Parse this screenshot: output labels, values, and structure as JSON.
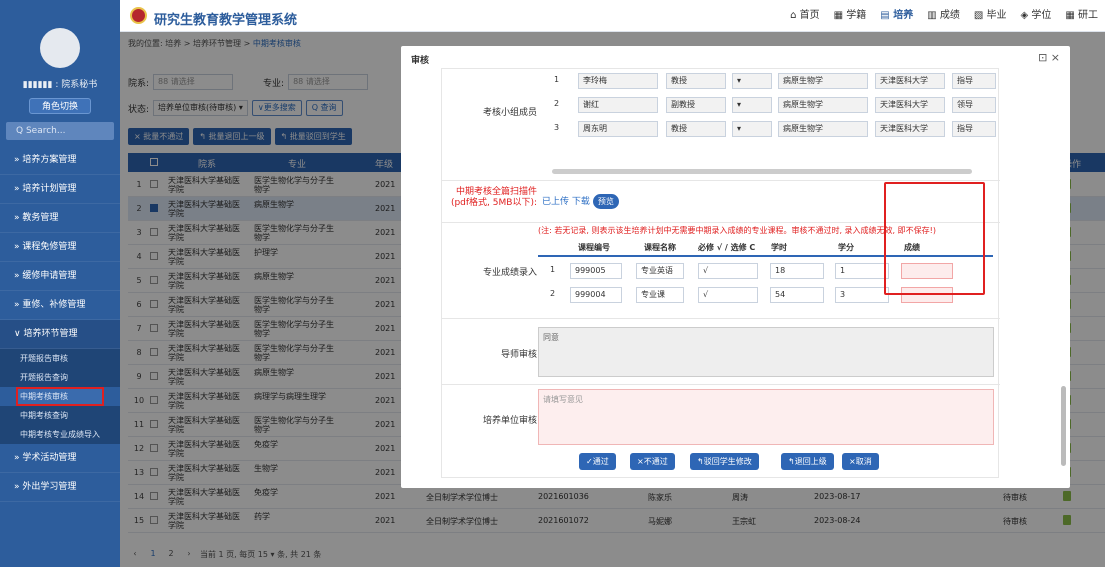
{
  "app": {
    "title": "研究生教育教学管理系统"
  },
  "topnav": [
    {
      "label": "⌂ 首页",
      "active": false
    },
    {
      "label": "▦ 学籍",
      "active": false
    },
    {
      "label": "▤ 培养",
      "active": true
    },
    {
      "label": "▥ 成绩",
      "active": false
    },
    {
      "label": "▧ 毕业",
      "active": false
    },
    {
      "label": "◈ 学位",
      "active": false
    },
    {
      "label": "▦ 研工",
      "active": false
    }
  ],
  "sidebar": {
    "user": "▮▮▮▮▮▮ : 院系秘书",
    "role_button": "角色切换",
    "search_placeholder": "Q  Search...",
    "menu": [
      {
        "label": "»  培养方案管理"
      },
      {
        "label": "»  培养计划管理"
      },
      {
        "label": "»  教务管理"
      },
      {
        "label": "»  课程免修管理"
      },
      {
        "label": "»  缓修申请管理"
      },
      {
        "label": "»  重修、补修管理"
      },
      {
        "label": "∨  培养环节管理"
      }
    ],
    "submenu": [
      {
        "label": "开题报告审核"
      },
      {
        "label": "开题报告查询"
      },
      {
        "label": "中期考核审核"
      },
      {
        "label": "中期考核查询"
      },
      {
        "label": "中期考核专业成绩导入"
      }
    ],
    "menu_after": [
      {
        "label": "»  学术活动管理"
      },
      {
        "label": "»  外出学习管理"
      }
    ]
  },
  "breadcrumb": {
    "prefix": "我的位置:  培养 > 培养环节管理 > ",
    "current": "中期考核审核"
  },
  "filters": {
    "dept_label": "院系:",
    "dept_value": "88  请选择",
    "major_label": "专业:",
    "major_value": "88  请选择",
    "status_label": "状态:",
    "status_value": "培养单位审核(待审核) ▾",
    "more_search": "∨更多搜索",
    "query": "Q 查询"
  },
  "actions": {
    "reject": "× 批量不通过",
    "back_one": "↰ 批量退回上一级",
    "back_student": "↰ 批量驳回到学生"
  },
  "table": {
    "headers": [
      "院系",
      "专业",
      "年级",
      "操作"
    ],
    "rows": [
      {
        "num": "1",
        "college": "天津医科大学基础医学院",
        "major": "医学生物化学与分子生物学",
        "year": "2021",
        "selected": false
      },
      {
        "num": "2",
        "college": "天津医科大学基础医学院",
        "major": "病原生物学",
        "year": "2021",
        "selected": true
      },
      {
        "num": "3",
        "college": "天津医科大学基础医学院",
        "major": "医学生物化学与分子生物学",
        "year": "2021",
        "selected": false
      },
      {
        "num": "4",
        "college": "天津医科大学基础医学院",
        "major": "护理学",
        "year": "2021",
        "selected": false
      },
      {
        "num": "5",
        "college": "天津医科大学基础医学院",
        "major": "病原生物学",
        "year": "2021",
        "selected": false
      },
      {
        "num": "6",
        "college": "天津医科大学基础医学院",
        "major": "医学生物化学与分子生物学",
        "year": "2021",
        "selected": false
      },
      {
        "num": "7",
        "college": "天津医科大学基础医学院",
        "major": "医学生物化学与分子生物学",
        "year": "2021",
        "selected": false
      },
      {
        "num": "8",
        "college": "天津医科大学基础医学院",
        "major": "医学生物化学与分子生物学",
        "year": "2021",
        "selected": false
      },
      {
        "num": "9",
        "college": "天津医科大学基础医学院",
        "major": "病原生物学",
        "year": "2021",
        "selected": false
      },
      {
        "num": "10",
        "college": "天津医科大学基础医学院",
        "major": "病理学与病理生理学",
        "year": "2021",
        "selected": false
      },
      {
        "num": "11",
        "college": "天津医科大学基础医学院",
        "major": "医学生物化学与分子生物学",
        "year": "2021",
        "selected": false
      },
      {
        "num": "12",
        "college": "天津医科大学基础医学院",
        "major": "免疫学",
        "year": "2021",
        "selected": false
      },
      {
        "num": "13",
        "college": "天津医科大学基础医学院",
        "major": "生物学",
        "year": "2021",
        "selected": false
      },
      {
        "num": "14",
        "college": "天津医科大学基础医学院",
        "major": "免疫学",
        "year": "2021",
        "selected": false,
        "type": "全日制学术学位博士",
        "sid": "2021601036",
        "sname": "陈家乐",
        "tname": "周涛",
        "date": "2023-08-17",
        "status": "待审核"
      },
      {
        "num": "15",
        "college": "天津医科大学基础医学院",
        "major": "药学",
        "year": "2021",
        "selected": false,
        "type": "全日制学术学位博士",
        "sid": "2021601072",
        "sname": "马妮娜",
        "tname": "王宗虹",
        "date": "2023-08-24",
        "status": "待审核"
      }
    ]
  },
  "pager": {
    "text": "当前 1 页, 每页 15 ▾ 条, 共 21 条",
    "pages": [
      "‹",
      "1",
      "2",
      "›"
    ]
  },
  "modal": {
    "title": "审核",
    "icons": "⊡  ×",
    "panel_label": "考核小组成员",
    "members": [
      {
        "no": "1",
        "name": "李玲梅",
        "title": "教授",
        "major": "病原生物学",
        "unit": "天津医科大学",
        "role": "指导"
      },
      {
        "no": "2",
        "name": "谢红",
        "title": "副教授",
        "major": "病原生物学",
        "unit": "天津医科大学",
        "role": "领导"
      },
      {
        "no": "3",
        "name": "周东明",
        "title": "教授",
        "major": "病原生物学",
        "unit": "天津医科大学",
        "role": "指导"
      }
    ],
    "attach_label": "中期考核全篇扫描件\n(pdf格式, 5MB以下):",
    "attach_status": "已上传 下载",
    "preview": "预览",
    "score_label": "专业成绩录入",
    "score_note": "(注: 若无记录, 则表示该生培养计划中无需要中期录入成绩的专业课程。审核不通过时, 录入成绩无效, 即不保存!)",
    "score_headers": [
      "课程编号",
      "课程名称",
      "必修 √ / 选修 C",
      "学时",
      "学分",
      "成绩"
    ],
    "courses": [
      {
        "no": "1",
        "code": "999005",
        "name": "专业英语",
        "req": "√",
        "hours": "18",
        "credit": "1",
        "score": ""
      },
      {
        "no": "2",
        "code": "999004",
        "name": "专业课",
        "req": "√",
        "hours": "54",
        "credit": "3",
        "score": ""
      }
    ],
    "advisor_label": "导师审核",
    "advisor_text": "同意",
    "unit_label": "培养单位审核",
    "unit_placeholder": "请填写意见",
    "buttons": {
      "pass": "✓通过",
      "fail": "×不通过",
      "reject_student": "↰驳回学生修改",
      "back_up": "↰退回上级",
      "cancel": "×取消"
    }
  },
  "colors": {
    "primary": "#2e66b5",
    "sidebar": "#2d5d9c",
    "highlight": "#e02020"
  }
}
